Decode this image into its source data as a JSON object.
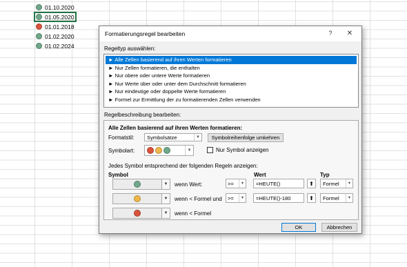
{
  "sheet": {
    "rows": [
      {
        "date": "01.10.2020",
        "color": "#6fa88a",
        "selected": false
      },
      {
        "date": "01.05.2020",
        "color": "#6fa88a",
        "selected": true
      },
      {
        "date": "01.01.2018",
        "color": "#d9533a",
        "selected": false
      },
      {
        "date": "01.02.2020",
        "color": "#6fa88a",
        "selected": false
      },
      {
        "date": "01.02.2024",
        "color": "#6fa88a",
        "selected": false
      }
    ]
  },
  "dialog": {
    "title": "Formatierungsregel bearbeiten",
    "help_label": "?",
    "close_label": "✕",
    "rule_type_label": "Regeltyp auswählen:",
    "rule_types": [
      "► Alle Zellen basierend auf ihren Werten formatieren",
      "► Nur Zellen formatieren, die enthalten",
      "► Nur obere oder untere Werte formatieren",
      "► Nur Werte über oder unter dem Durchschnitt formatieren",
      "► Nur eindeutige oder doppelte Werte formatieren",
      "► Formel zur Ermittlung der zu formatierenden Zellen verwenden"
    ],
    "description_label": "Regelbeschreibung bearbeiten:",
    "description_heading": "Alle Zellen basierend auf ihren Werten formatieren:",
    "format_style_label": "Formatstil:",
    "format_style_value": "Symbolsätze",
    "reverse_button": "Symbolreihenfolge umkehren",
    "icon_style_label": "Symbolart:",
    "icon_style_colors": [
      "#d9533a",
      "#f0b74a",
      "#6fa88a"
    ],
    "show_icon_only_label": "Nur Symbol anzeigen",
    "rules_intro": "Jedes Symbol entsprechend der folgenden Regeln anzeigen:",
    "col_symbol": "Symbol",
    "col_value": "Wert",
    "col_type": "Typ",
    "rules": [
      {
        "color": "#6fa88a",
        "condition": "wenn Wert:",
        "operator": ">=",
        "value": "=HEUTE()",
        "type": "Formel"
      },
      {
        "color": "#f0b74a",
        "condition": "wenn < Formel und",
        "operator": ">=",
        "value": "=HEUTE()-180",
        "type": "Formel"
      },
      {
        "color": "#d9533a",
        "condition": "wenn < Formel"
      }
    ],
    "ok_label": "OK",
    "cancel_label": "Abbrechen"
  }
}
